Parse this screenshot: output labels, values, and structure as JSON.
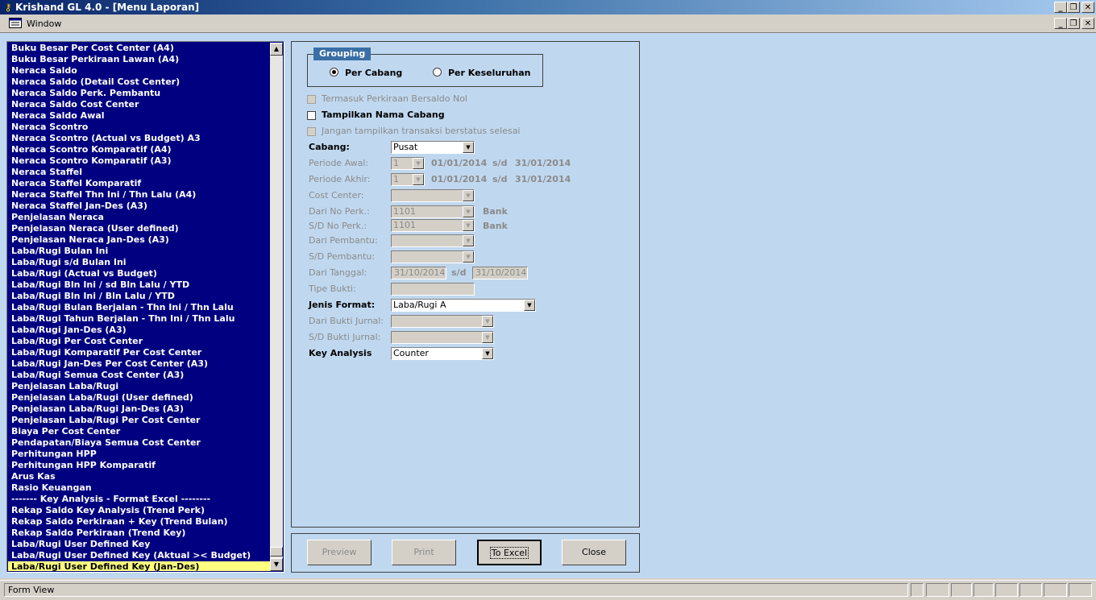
{
  "window": {
    "title": "Krishand GL 4.0 - [Menu Laporan]"
  },
  "menubar": {
    "window_label": "Window"
  },
  "report_list": {
    "items": [
      "Buku Besar Per Cost Center (A4)",
      "Buku Besar Perkiraan Lawan (A4)",
      "Neraca Saldo",
      "Neraca Saldo (Detail Cost Center)",
      "Neraca Saldo Perk. Pembantu",
      "Neraca Saldo Cost Center",
      "Neraca Saldo Awal",
      "Neraca Scontro",
      "Neraca Scontro (Actual vs Budget) A3",
      "Neraca Scontro Komparatif (A4)",
      "Neraca Scontro Komparatif (A3)",
      "Neraca Staffel",
      "Neraca Staffel Komparatif",
      "Neraca Staffel Thn Ini / Thn Lalu (A4)",
      "Neraca Staffel Jan-Des (A3)",
      "Penjelasan Neraca",
      "Penjelasan Neraca (User defined)",
      "Penjelasan Neraca Jan-Des (A3)",
      "Laba/Rugi Bulan Ini",
      "Laba/Rugi s/d Bulan Ini",
      "Laba/Rugi (Actual vs Budget)",
      "Laba/Rugi Bln Ini / sd Bln Lalu / YTD",
      "Laba/Rugi Bln Ini / Bln Lalu / YTD",
      "Laba/Rugi Bulan Berjalan - Thn Ini / Thn Lalu",
      "Laba/Rugi Tahun Berjalan - Thn Ini / Thn Lalu",
      "Laba/Rugi Jan-Des (A3)",
      "Laba/Rugi Per Cost Center",
      "Laba/Rugi Komparatif Per Cost Center",
      "Laba/Rugi Jan-Des Per Cost Center (A3)",
      "Laba/Rugi Semua Cost Center (A3)",
      "Penjelasan Laba/Rugi",
      "Penjelasan Laba/Rugi (User defined)",
      "Penjelasan Laba/Rugi Jan-Des (A3)",
      "Penjelasan Laba/Rugi Per Cost Center",
      "Biaya Per Cost Center",
      "Pendapatan/Biaya Semua Cost Center",
      "Perhitungan HPP",
      "Perhitungan HPP Komparatif",
      "Arus Kas",
      "Rasio Keuangan",
      "------- Key Analysis - Format Excel --------",
      "Rekap Saldo Key Analysis (Trend Perk)",
      "Rekap Saldo Perkiraan + Key (Trend Bulan)",
      "Rekap Saldo Perkiraan (Trend Key)",
      "Laba/Rugi User Defined Key",
      "Laba/Rugi User Defined Key (Aktual >< Budget)",
      "Laba/Rugi User Defined Key (Jan-Des)"
    ],
    "selected_index": 46
  },
  "grouping": {
    "title": "Grouping",
    "per_cabang": "Per Cabang",
    "per_keseluruhan": "Per Keseluruhan",
    "selected": "per_cabang"
  },
  "options": {
    "termasuk": "Termasuk Perkiraan Bersaldo Nol",
    "tampilkan": "Tampilkan Nama Cabang",
    "jangan": "Jangan tampilkan transaksi berstatus selesai"
  },
  "form": {
    "cabang_label": "Cabang:",
    "cabang_value": "Pusat",
    "periode_awal_label": "Periode Awal:",
    "periode_awal_value": "1",
    "periode_awal_from": "01/01/2014",
    "periode_awal_to": "31/01/2014",
    "periode_akhir_label": "Periode Akhir:",
    "periode_akhir_value": "1",
    "periode_akhir_from": "01/01/2014",
    "periode_akhir_to": "31/01/2014",
    "sd": "s/d",
    "cost_center_label": "Cost Center:",
    "dari_no_perk_label": "Dari No Perk.:",
    "dari_no_perk_value": "1101",
    "dari_no_perk_name": "Bank",
    "sd_no_perk_label": "S/D No Perk.:",
    "sd_no_perk_value": "1101",
    "sd_no_perk_name": "Bank",
    "dari_pembantu_label": "Dari Pembantu:",
    "sd_pembantu_label": "S/D Pembantu:",
    "dari_tanggal_label": "Dari Tanggal:",
    "dari_tanggal_value": "31/10/2014",
    "sd_tanggal_value": "31/10/2014",
    "tipe_bukti_label": "Tipe Bukti:",
    "jenis_format_label": "Jenis Format:",
    "jenis_format_value": "Laba/Rugi A",
    "dari_bukti_label": "Dari Bukti Jurnal:",
    "sd_bukti_label": "S/D Bukti Jurnal:",
    "key_analysis_label": "Key Analysis",
    "key_analysis_value": "Counter"
  },
  "buttons": {
    "preview": "Preview",
    "print": "Print",
    "to_excel": "To Excel",
    "close": "Close"
  },
  "status": {
    "text": "Form View"
  },
  "colors": {
    "list_bg": "#000080",
    "selected_bg": "#ffff80",
    "client_bg": "#c0d8ef"
  },
  "icons": {
    "app": "key-icon",
    "mdi": "window-icon",
    "scroll_up": "arrow-up-icon",
    "scroll_down": "arrow-down-icon"
  }
}
